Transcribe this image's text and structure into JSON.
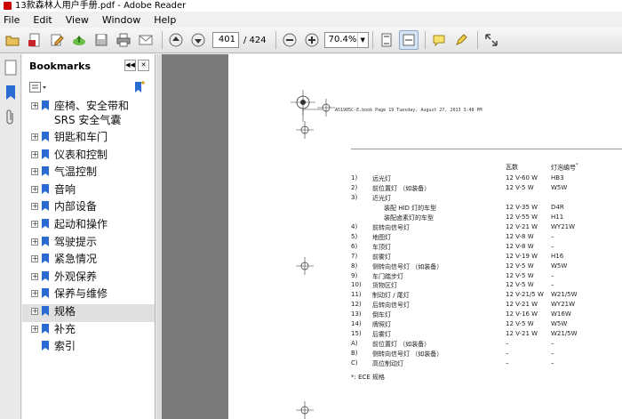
{
  "window": {
    "title": "13款森林人用户手册.pdf - Adobe Reader"
  },
  "menu": [
    "File",
    "Edit",
    "View",
    "Window",
    "Help"
  ],
  "toolbar": {
    "page_current": "401",
    "page_total": "/ 424",
    "zoom": "70.4%"
  },
  "bookmarks": {
    "title": "Bookmarks",
    "items": [
      {
        "label": "座椅、安全带和 SRS 安全气囊",
        "expandable": true
      },
      {
        "label": "钥匙和车门",
        "expandable": true
      },
      {
        "label": "仪表和控制",
        "expandable": true
      },
      {
        "label": "气温控制",
        "expandable": true
      },
      {
        "label": "音响",
        "expandable": true
      },
      {
        "label": "内部设备",
        "expandable": true
      },
      {
        "label": "起动和操作",
        "expandable": true
      },
      {
        "label": "驾驶提示",
        "expandable": true
      },
      {
        "label": "紧急情况",
        "expandable": true
      },
      {
        "label": "外观保养",
        "expandable": true
      },
      {
        "label": "保养与维修",
        "expandable": true
      },
      {
        "label": "规格",
        "expandable": true,
        "selected": true
      },
      {
        "label": "补充",
        "expandable": true
      },
      {
        "label": "索引",
        "expandable": false
      }
    ]
  },
  "document": {
    "header": "A51905C-E.book  Page 19  Tuesday, August 27, 2013  3:48 PM",
    "col_watt": "瓦数",
    "col_bulb": "灯泡编号",
    "col_bulb_mark": "*",
    "rows": [
      {
        "no": "1)",
        "name": "远光灯",
        "watt": "12 V-60 W",
        "bulb": "HB3"
      },
      {
        "no": "2)",
        "name": "前位置灯 （如装备）",
        "watt": "12 V-5 W",
        "bulb": "W5W"
      },
      {
        "no": "3)",
        "name": "近光灯",
        "watt": "",
        "bulb": ""
      },
      {
        "no": "",
        "name": "装配 HID 灯的车型",
        "watt": "12 V-35 W",
        "bulb": "D4R",
        "indent": true
      },
      {
        "no": "",
        "name": "装配卤素灯的车型",
        "watt": "12 V-55 W",
        "bulb": "H11",
        "indent": true
      },
      {
        "no": "4)",
        "name": "前转向信号灯",
        "watt": "12 V-21 W",
        "bulb": "WY21W"
      },
      {
        "no": "5)",
        "name": "地图灯",
        "watt": "12 V-8 W",
        "bulb": "–"
      },
      {
        "no": "6)",
        "name": "车顶灯",
        "watt": "12 V-8 W",
        "bulb": "–"
      },
      {
        "no": "7)",
        "name": "前雾灯",
        "watt": "12 V-19 W",
        "bulb": "H16"
      },
      {
        "no": "8)",
        "name": "侧转向信号灯 （如装备）",
        "watt": "12 V-5 W",
        "bulb": "W5W"
      },
      {
        "no": "9)",
        "name": "车门踏步灯",
        "watt": "12 V-5 W",
        "bulb": "–"
      },
      {
        "no": "10)",
        "name": "货物区灯",
        "watt": "12 V-5 W",
        "bulb": "–"
      },
      {
        "no": "11)",
        "name": "制动灯 / 尾灯",
        "watt": "12 V-21/5 W",
        "bulb": "W21/5W"
      },
      {
        "no": "12)",
        "name": "后转向信号灯",
        "watt": "12 V-21 W",
        "bulb": "WY21W"
      },
      {
        "no": "13)",
        "name": "倒车灯",
        "watt": "12 V-16 W",
        "bulb": "W16W"
      },
      {
        "no": "14)",
        "name": "牌照灯",
        "watt": "12 V-5 W",
        "bulb": "W5W"
      },
      {
        "no": "15)",
        "name": "后雾灯",
        "watt": "12 V-21 W",
        "bulb": "W21/5W"
      },
      {
        "no": "A)",
        "name": "前位置灯 （如装备）",
        "watt": "–",
        "bulb": "–"
      },
      {
        "no": "B)",
        "name": "侧转向信号灯 （如装备）",
        "watt": "–",
        "bulb": "–"
      },
      {
        "no": "C)",
        "name": "高位制动灯",
        "watt": "–",
        "bulb": "–"
      }
    ],
    "footnote": "*: ECE 规格"
  },
  "colors": {
    "viewer_bg": "#7a7a7a",
    "selected_bg": "#e0e0e0",
    "accent": "#2a6bd1"
  }
}
